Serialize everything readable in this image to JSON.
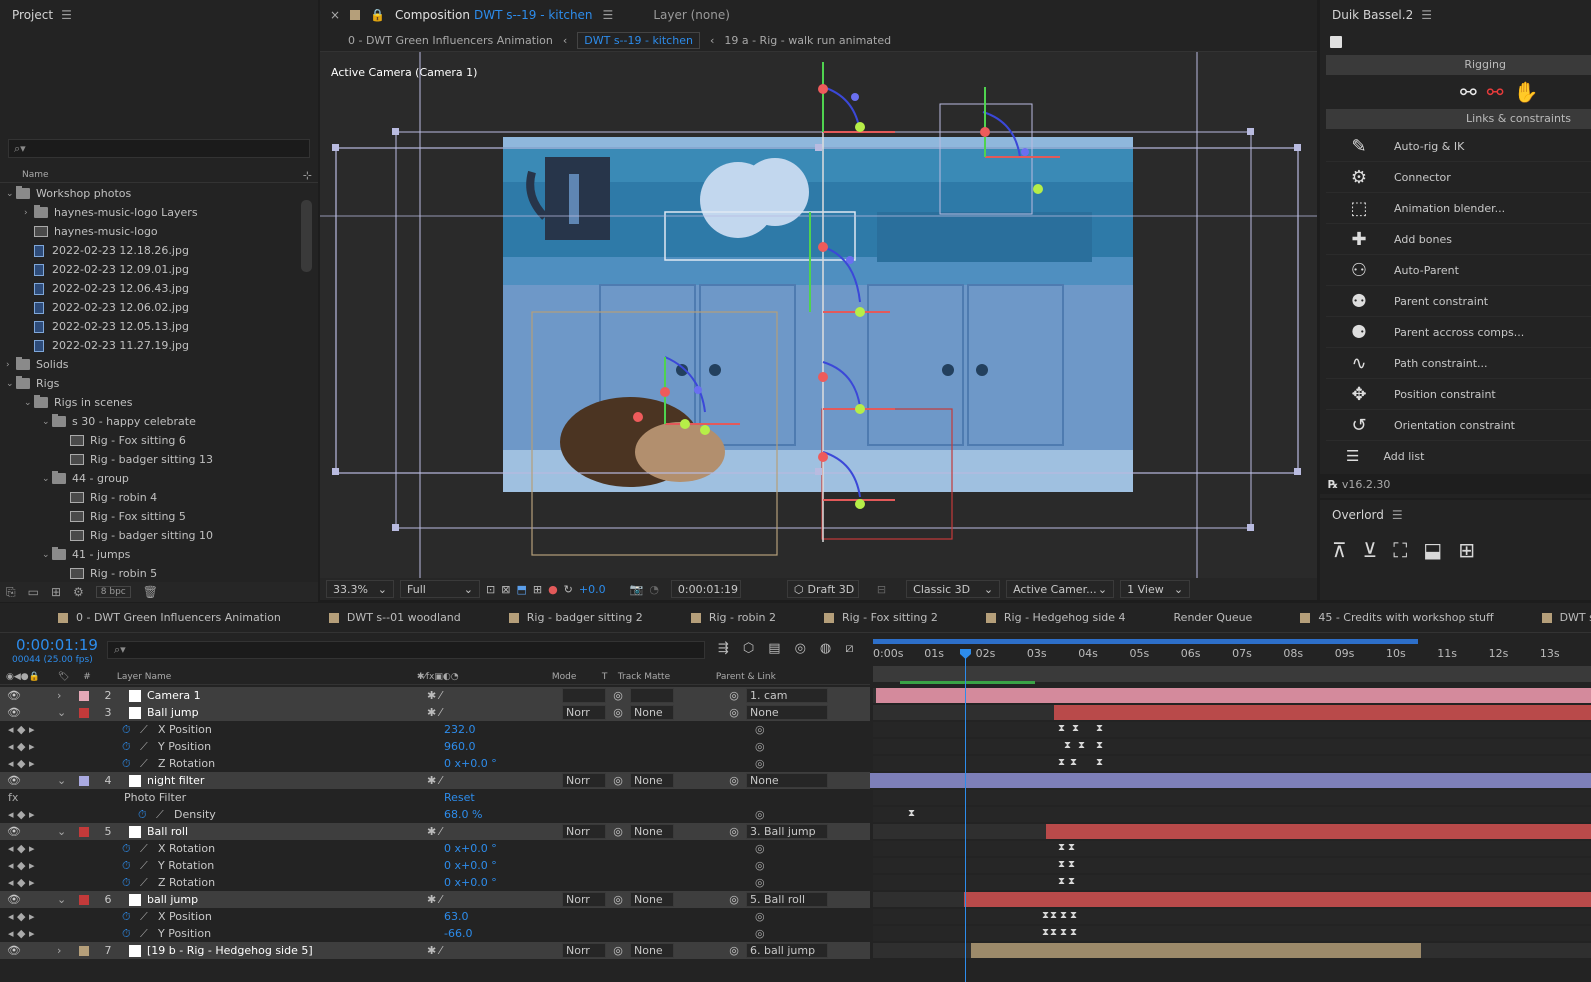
{
  "project": {
    "title": "Project",
    "search_placeholder": "",
    "column_name": "Name",
    "bpc": "8 bpc",
    "items": [
      {
        "label": "Workshop photos",
        "indent": 0,
        "type": "folder",
        "open": true
      },
      {
        "label": "haynes-music-logo Layers",
        "indent": 1,
        "type": "folder",
        "open": false
      },
      {
        "label": "haynes-music-logo",
        "indent": 1,
        "type": "comp"
      },
      {
        "label": "2022-02-23 12.18.26.jpg",
        "indent": 1,
        "type": "jpg"
      },
      {
        "label": "2022-02-23 12.09.01.jpg",
        "indent": 1,
        "type": "jpg"
      },
      {
        "label": "2022-02-23 12.06.43.jpg",
        "indent": 1,
        "type": "jpg"
      },
      {
        "label": "2022-02-23 12.06.02.jpg",
        "indent": 1,
        "type": "jpg"
      },
      {
        "label": "2022-02-23 12.05.13.jpg",
        "indent": 1,
        "type": "jpg"
      },
      {
        "label": "2022-02-23 11.27.19.jpg",
        "indent": 1,
        "type": "jpg"
      },
      {
        "label": "Solids",
        "indent": 0,
        "type": "folder",
        "open": false
      },
      {
        "label": "Rigs",
        "indent": 0,
        "type": "folder",
        "open": true
      },
      {
        "label": "Rigs in scenes",
        "indent": 1,
        "type": "folder",
        "open": true
      },
      {
        "label": "s 30 - happy celebrate",
        "indent": 2,
        "type": "folder",
        "open": true
      },
      {
        "label": "Rig - Fox sitting 6",
        "indent": 3,
        "type": "comp"
      },
      {
        "label": "Rig - badger sitting 13",
        "indent": 3,
        "type": "comp"
      },
      {
        "label": "44 - group",
        "indent": 2,
        "type": "folder",
        "open": true
      },
      {
        "label": "Rig - robin 4",
        "indent": 3,
        "type": "comp"
      },
      {
        "label": "Rig - Fox sitting 5",
        "indent": 3,
        "type": "comp"
      },
      {
        "label": "Rig - badger sitting 10",
        "indent": 3,
        "type": "comp"
      },
      {
        "label": "41 - jumps",
        "indent": 2,
        "type": "folder",
        "open": true
      },
      {
        "label": "Rig - robin 5",
        "indent": 3,
        "type": "comp"
      }
    ]
  },
  "comp": {
    "tab_prefix": "Composition",
    "tab_name": "DWT s--19 - kitchen",
    "layer_tab": "Layer (none)",
    "crumbs": [
      "0 - DWT Green Influencers Animation",
      "DWT s--19 - kitchen",
      "19 a - Rig - walk run animated"
    ],
    "camera_label": "Active Camera (Camera 1)",
    "zoom": "33.3%",
    "resolution": "Full",
    "exposure": "+0.0",
    "timecode": "0:00:01:19",
    "draft": "Draft 3D",
    "renderer": "Classic 3D",
    "camera": "Active Camer...",
    "views": "1 View"
  },
  "duik": {
    "title": "Duik Bassel.2",
    "section_rigging": "Rigging",
    "section_links": "Links & constraints",
    "tools": [
      {
        "label": "Auto-rig & IK",
        "icon": "auto-rig-icon"
      },
      {
        "label": "Connector",
        "icon": "connector-icon"
      },
      {
        "label": "Animation blender...",
        "icon": "animation-blender-icon"
      },
      {
        "label": "Add bones",
        "icon": "add-bones-icon"
      },
      {
        "label": "Auto-Parent",
        "icon": "auto-parent-icon"
      },
      {
        "label": "Parent constraint",
        "icon": "parent-constraint-icon"
      },
      {
        "label": "Parent accross comps...",
        "icon": "parent-across-comps-icon"
      },
      {
        "label": "Path constraint...",
        "icon": "path-constraint-icon"
      },
      {
        "label": "Position constraint",
        "icon": "position-constraint-icon"
      },
      {
        "label": "Orientation constraint",
        "icon": "orientation-constraint-icon"
      }
    ],
    "add_list": "Add list",
    "version": "v16.2.30"
  },
  "overlord": {
    "title": "Overlord"
  },
  "timeline": {
    "tabs": [
      {
        "label": "0 - DWT Green Influencers Animation",
        "color": "#b59f7a"
      },
      {
        "label": "DWT s--01  woodland",
        "color": "#b59f7a"
      },
      {
        "label": "Rig - badger sitting 2",
        "color": "#b59f7a"
      },
      {
        "label": "Rig - robin 2",
        "color": "#b59f7a"
      },
      {
        "label": "Rig - Fox sitting 2",
        "color": "#b59f7a"
      },
      {
        "label": "Rig - Hedgehog side 4",
        "color": "#b59f7a"
      },
      {
        "label": "Render Queue",
        "color": ""
      },
      {
        "label": "45 - Credits with workshop stuff",
        "color": "#b59f7a"
      },
      {
        "label": "DWT s--",
        "color": "#b59f7a"
      }
    ],
    "timecode": "0:00:01:19",
    "frame_info": "00044 (25.00 fps)",
    "columns": {
      "layer_name": "Layer Name",
      "mode": "Mode",
      "t": "T",
      "track_matte": "Track Matte",
      "parent": "Parent & Link"
    },
    "ruler": [
      "0:00s",
      "01s",
      "02s",
      "03s",
      "04s",
      "05s",
      "06s",
      "07s",
      "08s",
      "09s",
      "10s",
      "11s",
      "12s",
      "13s"
    ],
    "rows": [
      {
        "kind": "layer",
        "num": "2",
        "name": "Camera 1",
        "color": "#e6a9b8",
        "parent": "1. cam",
        "mode": "",
        "matte": ""
      },
      {
        "kind": "layer",
        "num": "3",
        "name": "Ball jump",
        "color": "#c33a3a",
        "parent": "None",
        "mode": "Norr",
        "matte": "None"
      },
      {
        "kind": "prop",
        "name": "X Position",
        "value": "232.0"
      },
      {
        "kind": "prop",
        "name": "Y Position",
        "value": "960.0"
      },
      {
        "kind": "prop",
        "name": "Z Rotation",
        "value": "0 x+0.0 °"
      },
      {
        "kind": "layer",
        "num": "4",
        "name": "night filter",
        "color": "#a9a9e0",
        "parent": "None",
        "mode": "Norr",
        "matte": "None"
      },
      {
        "kind": "effect",
        "name": "Photo Filter",
        "value": "Reset"
      },
      {
        "kind": "prop2",
        "name": "Density",
        "value": "68.0 %"
      },
      {
        "kind": "layer",
        "num": "5",
        "name": "Ball roll",
        "color": "#c33a3a",
        "parent": "3. Ball jump",
        "mode": "Norr",
        "matte": "None"
      },
      {
        "kind": "prop",
        "name": "X Rotation",
        "value": "0 x+0.0 °"
      },
      {
        "kind": "prop",
        "name": "Y Rotation",
        "value": "0 x+0.0 °"
      },
      {
        "kind": "prop",
        "name": "Z Rotation",
        "value": "0 x+0.0 °"
      },
      {
        "kind": "layer",
        "num": "6",
        "name": "ball jump",
        "color": "#c33a3a",
        "parent": "5. Ball roll",
        "mode": "Norr",
        "matte": "None"
      },
      {
        "kind": "prop",
        "name": "X Position",
        "value": "63.0"
      },
      {
        "kind": "prop",
        "name": "Y Position",
        "value": "-66.0"
      },
      {
        "kind": "layer",
        "num": "7",
        "name": "[19 b - Rig - Hedgehog side 5]",
        "color": "#b59f7a",
        "parent": "6. ball jump",
        "mode": "Norr",
        "matte": "None"
      }
    ]
  }
}
